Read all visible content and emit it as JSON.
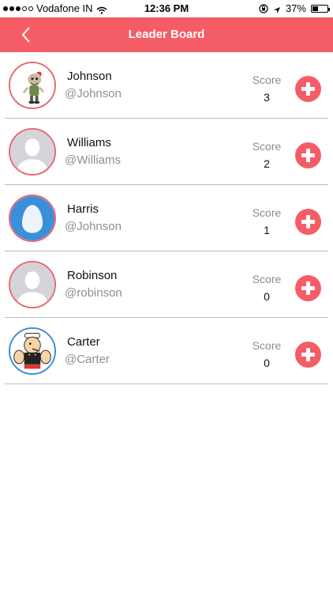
{
  "status_bar": {
    "carrier": "Vodafone IN",
    "time": "12:36 PM",
    "battery": "37%",
    "battery_level": 0.37
  },
  "header": {
    "title": "Leader Board"
  },
  "score_label": "Score",
  "players": [
    {
      "name": "Johnson",
      "handle": "@Johnson",
      "score": "3",
      "avatar": "cartoon-character"
    },
    {
      "name": "Williams",
      "handle": "@Williams",
      "score": "2",
      "avatar": "default-silhouette"
    },
    {
      "name": "Harris",
      "handle": "@Johnson",
      "score": "1",
      "avatar": "egg"
    },
    {
      "name": "Robinson",
      "handle": "@robinson",
      "score": "0",
      "avatar": "default-silhouette"
    },
    {
      "name": "Carter",
      "handle": "@Carter",
      "score": "0",
      "avatar": "popeye-cartoon"
    }
  ],
  "colors": {
    "accent": "#f55d66",
    "avatar_border": "#e66a72",
    "egg_bg": "#3b8fd9"
  }
}
